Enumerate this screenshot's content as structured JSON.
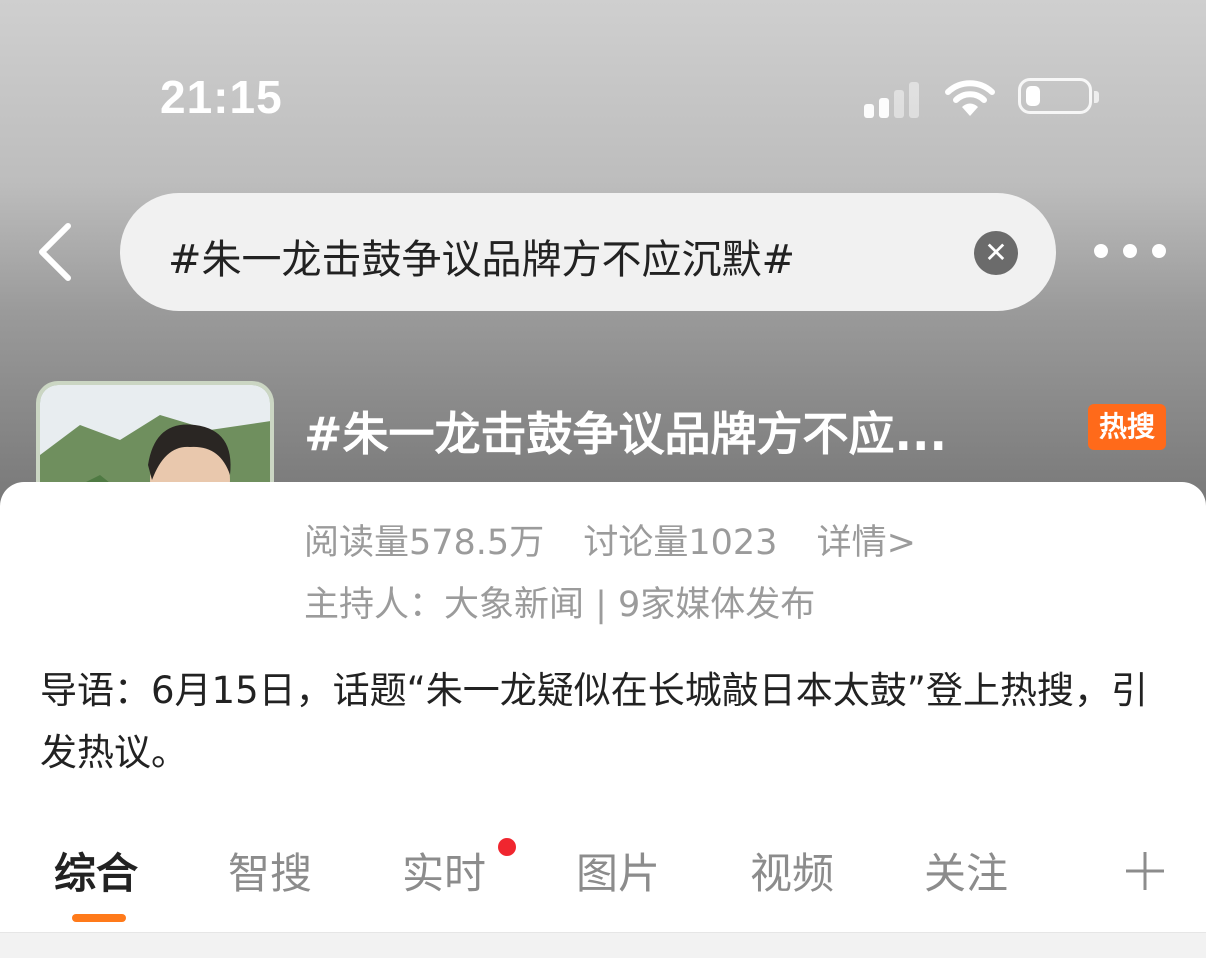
{
  "status_bar": {
    "time": "21:15"
  },
  "search": {
    "query": "#朱一龙击鼓争议品牌方不应沉默#",
    "clear_icon": "close-icon"
  },
  "topic": {
    "title": "#朱一龙击鼓争议品牌方不应...",
    "badge": "热搜",
    "reads": "阅读量578.5万",
    "discussions": "讨论量1023",
    "details_link": "详情>",
    "host": "主持人：大象新闻 | 9家媒体发布",
    "intro": "导语：6月15日，话题“朱一龙疑似在长城敲日本太鼓”登上热搜，引发热议。"
  },
  "tabs": [
    {
      "label": "综合"
    },
    {
      "label": "智搜"
    },
    {
      "label": "实时"
    },
    {
      "label": "图片"
    },
    {
      "label": "视频"
    },
    {
      "label": "关注"
    }
  ],
  "colors": {
    "accent": "#ff7a1a",
    "badge": "#ff6a1a",
    "notification_dot": "#f0262f"
  }
}
